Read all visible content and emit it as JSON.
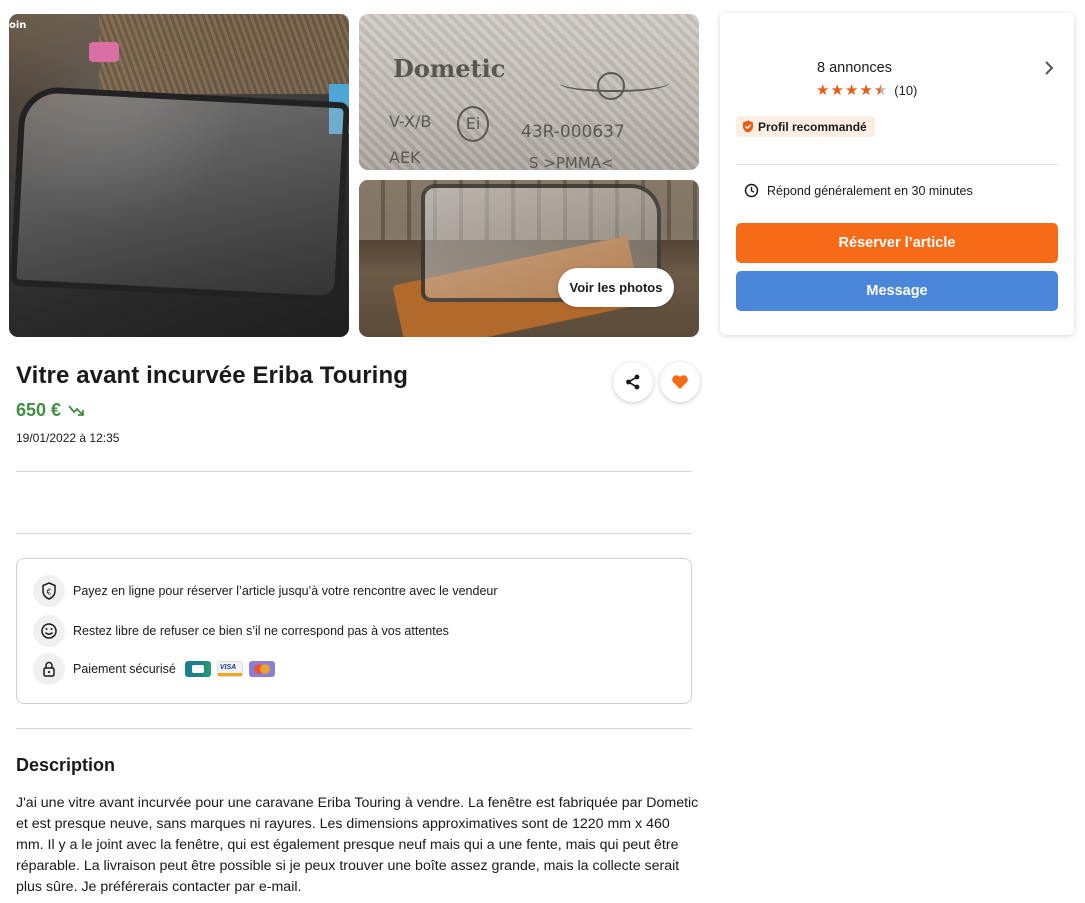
{
  "gallery": {
    "corner_label": "oin",
    "see_photos_label": "Voir les photos",
    "label_brand": "Dometic",
    "label_line1": "V-X/B",
    "label_line2": "AEK",
    "label_approval": "Ei",
    "label_code": "43R-000637",
    "label_code2": "S >PMMA<"
  },
  "listing": {
    "title": "Vitre avant incurvée Eriba Touring",
    "price": "650 €",
    "date": "19/01/2022 à 12:35",
    "price_color": "#3f8f3f"
  },
  "info": {
    "pay_online": "Payez en ligne pour réserver l’article jusqu’à votre rencontre avec le vendeur",
    "free_to_refuse": "Restez libre de refuser ce bien s’il ne correspond pas à vos attentes",
    "secure_payment": "Paiement sécurisé"
  },
  "description": {
    "heading": "Description",
    "body": "J'ai une vitre avant incurvée pour une caravane Eriba Touring à vendre. La fenêtre est fabriquée par Dometic et est presque neuve, sans marques ni rayures. Les dimensions approximatives sont de 1220 mm x 460 mm. Il y a le joint avec la fenêtre, qui est également presque neuf mais qui a une fente, mais qui peut être réparable. La livraison peut être possible si je peux trouver une boîte assez grande, mais la collecte serait plus sûre. Je préférerais contacter par e-mail."
  },
  "seller": {
    "listings_count": "8 annonces",
    "rating": 4.5,
    "rating_count": "(10)",
    "badge": "Profil recommandé",
    "response_time": "Répond généralement en 30 minutes",
    "reserve_label": "Réserver l’article",
    "message_label": "Message",
    "reserve_color": "#f56b17",
    "message_color": "#4a86d9",
    "star_color": "#ec5a13"
  },
  "icons": {
    "share": "share-icon",
    "favorite": "heart-icon",
    "trend": "trend-down-icon",
    "chevron": "chevron-right-icon",
    "badge": "shield-check-icon",
    "clock": "clock-icon",
    "euro_shield": "euro-shield-icon",
    "smiley": "smiley-icon",
    "lock": "lock-icon"
  }
}
